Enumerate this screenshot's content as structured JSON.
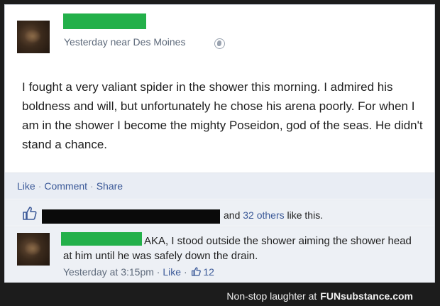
{
  "post": {
    "meta": "Yesterday near Des Moines",
    "text": "I fought a very valiant spider in the shower this morning. I admired his boldness and will, but unfortunately he chose his arena poorly. For when I am in the shower I become the mighty Poseidon, god of the seas. He didn't stand a chance."
  },
  "actions": {
    "like": "Like",
    "comment": "Comment",
    "share": "Share",
    "separator": "·"
  },
  "likes": {
    "prefix": "and ",
    "others_link": "32 others",
    "suffix": " like this."
  },
  "comment": {
    "text": "AKA, I stood outside the shower aiming the shower head at him until he was safely down the drain.",
    "time": "Yesterday at 3:15pm",
    "separator": "·",
    "like": "Like",
    "like_count": "12"
  },
  "footer": {
    "tagline": "Non-stop laughter at",
    "brand_fun": "FUN",
    "brand_sub": "substance.com"
  },
  "colors": {
    "link": "#3b5998",
    "redaction_name": "#23b04a",
    "redaction_black": "#0a0a0a"
  },
  "icons": {
    "privacy": "globe-icon",
    "likes": "thumbs-up-icon"
  }
}
